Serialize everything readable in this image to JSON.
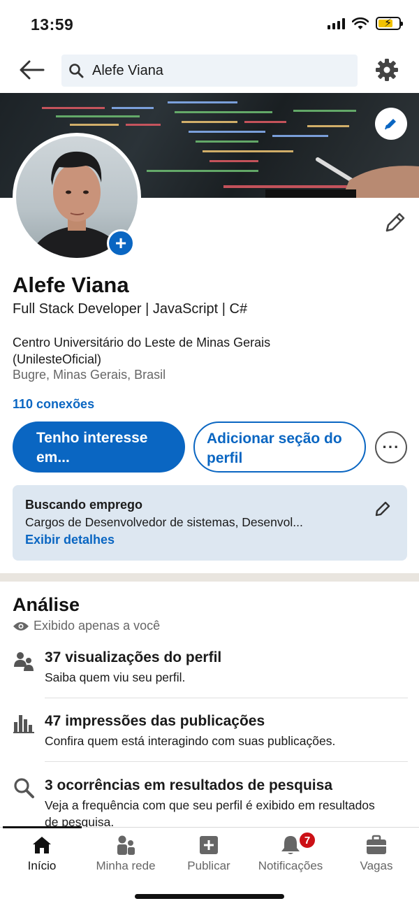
{
  "status_bar": {
    "time": "13:59"
  },
  "search": {
    "value": "Alefe Viana"
  },
  "profile": {
    "name": "Alefe Viana",
    "headline": "Full Stack Developer | JavaScript | C#",
    "education": "Centro Universitário do Leste de Minas Gerais (UnilesteOficial)",
    "location": "Bugre, Minas Gerais, Brasil",
    "connections": "110 conexões"
  },
  "actions": {
    "primary_label": "Tenho interesse em...",
    "secondary_label": "Adicionar seção do perfil",
    "more_label": "···"
  },
  "job_card": {
    "title": "Buscando emprego",
    "description": "Cargos de Desenvolvedor de sistemas, Desenvol...",
    "link": "Exibir detalhes"
  },
  "analytics": {
    "title": "Análise",
    "visibility": "Exibido apenas a você",
    "items": [
      {
        "icon": "people-icon",
        "title": "37 visualizações do perfil",
        "description": "Saiba quem viu seu perfil."
      },
      {
        "icon": "bar-chart-icon",
        "title": "47 impressões das publicações",
        "description": "Confira quem está interagindo com suas publicações."
      },
      {
        "icon": "search-icon",
        "title": "3 ocorrências em resultados de pesquisa",
        "description": "Veja a frequência com que seu perfil é exibido em resultados de pesquisa."
      }
    ]
  },
  "bottom_nav": {
    "items": [
      {
        "label": "Início",
        "icon": "home-icon",
        "active": true
      },
      {
        "label": "Minha rede",
        "icon": "network-icon"
      },
      {
        "label": "Publicar",
        "icon": "plus-square-icon"
      },
      {
        "label": "Notificações",
        "icon": "bell-icon",
        "badge": "7"
      },
      {
        "label": "Vagas",
        "icon": "briefcase-icon"
      }
    ]
  },
  "colors": {
    "brand": "#0a66c2",
    "card_bg": "#dde7f1",
    "badge": "#cc1016",
    "banner_code": [
      "#e15b64",
      "#6fbf73",
      "#f0c674",
      "#8ab4f8"
    ]
  }
}
